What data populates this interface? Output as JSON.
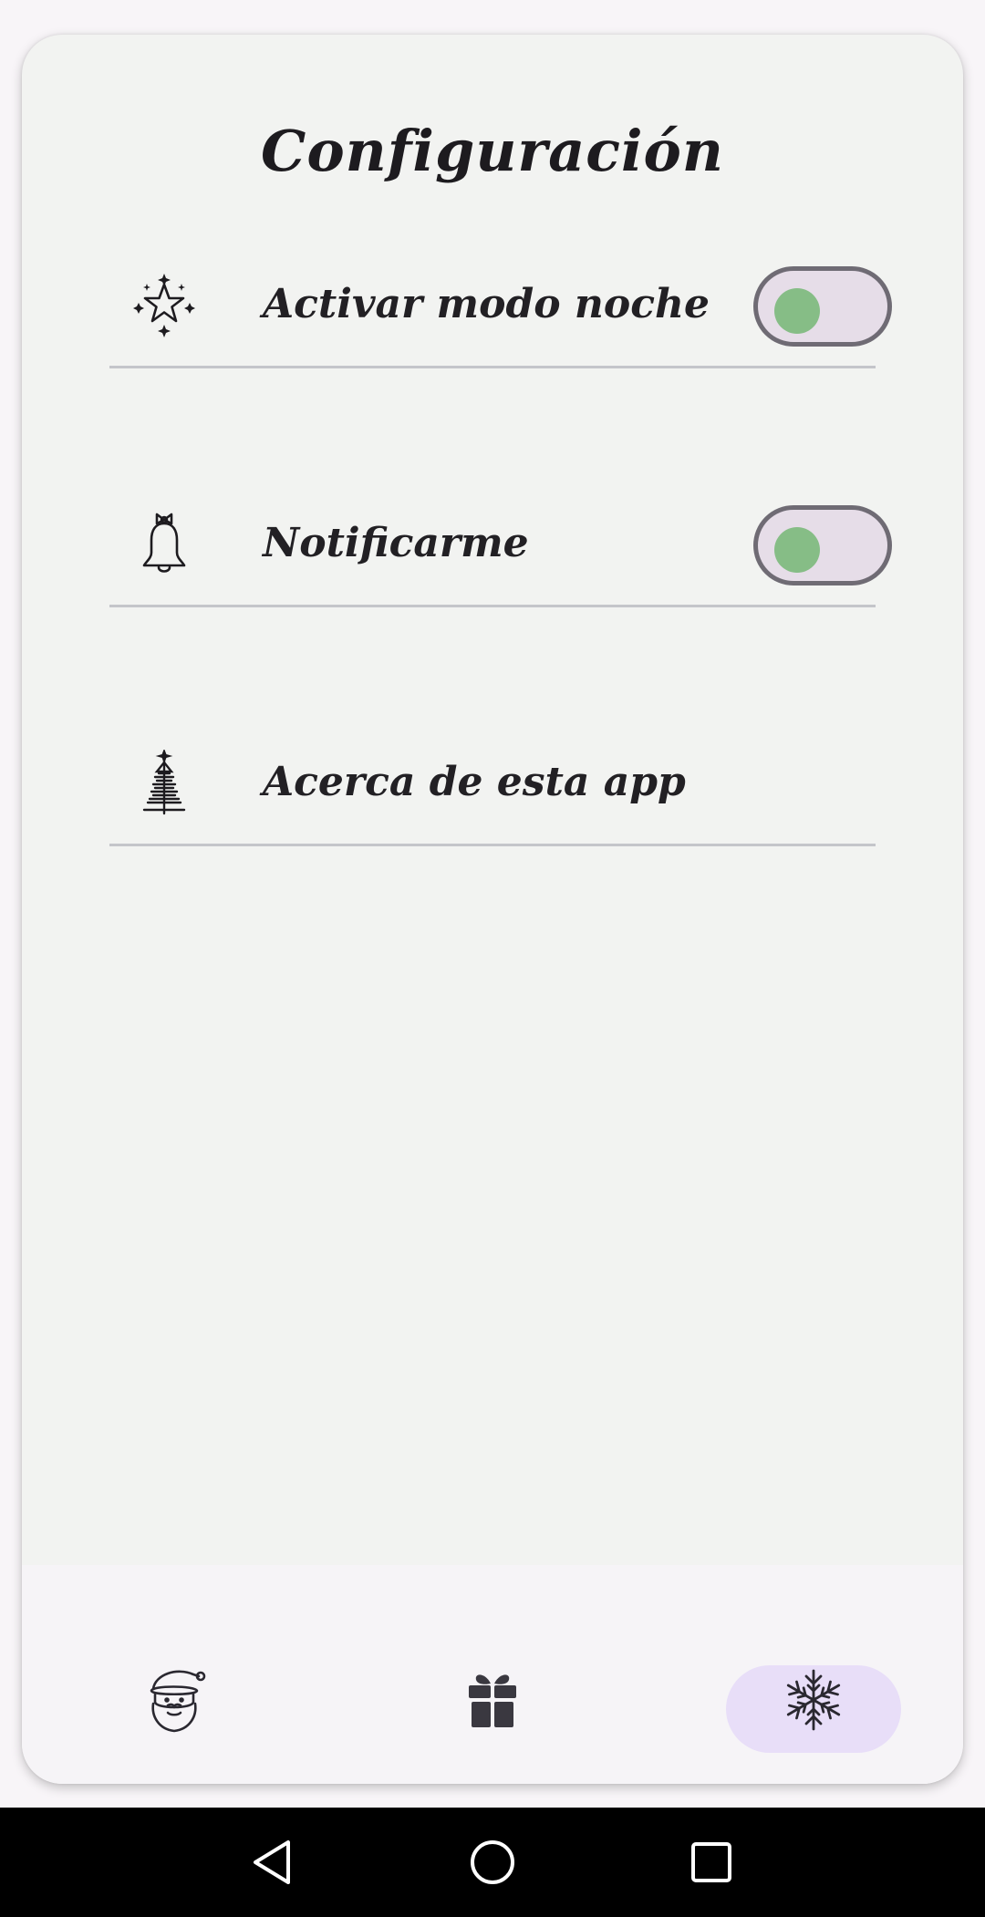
{
  "screen": {
    "title": "Configuración"
  },
  "settings": {
    "items": [
      {
        "label": "Activar modo noche",
        "icon": "sparkle-star-icon",
        "toggle": true,
        "enabled": false
      },
      {
        "label": "Notificarme",
        "icon": "bell-icon",
        "toggle": true,
        "enabled": false
      },
      {
        "label": "Acerca de esta app",
        "icon": "christmas-tree-icon",
        "toggle": false
      }
    ]
  },
  "bottom_nav": {
    "items": [
      {
        "icon": "santa-icon",
        "selected": false
      },
      {
        "icon": "gift-icon",
        "selected": false
      },
      {
        "icon": "snowflake-icon",
        "selected": true
      }
    ],
    "active_color": "#e8def8"
  },
  "system_nav": {
    "buttons": [
      "back-icon",
      "home-icon",
      "recents-icon"
    ]
  },
  "colors": {
    "card_bg": "#f2f3f1",
    "toggle_knob": "#86bd86",
    "toggle_track": "#e6dde8",
    "text": "#1d1b1f"
  }
}
